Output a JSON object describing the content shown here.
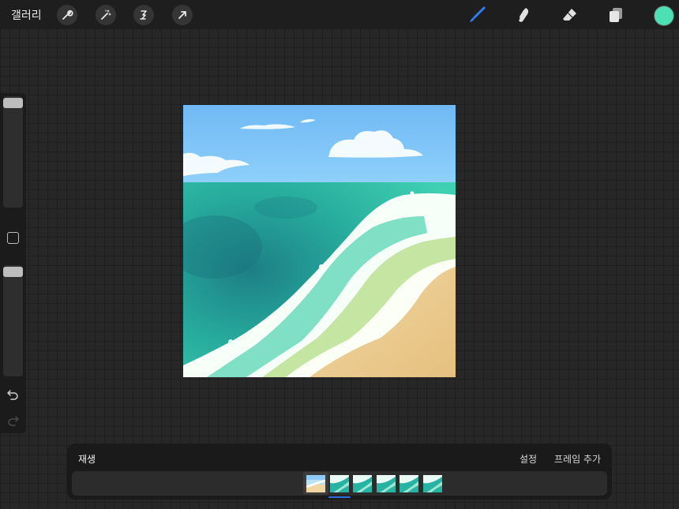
{
  "topbar": {
    "gallery_label": "갤러리",
    "left_tools": [
      "wrench-icon",
      "magic-wand-icon",
      "selection-icon",
      "transform-arrow-icon"
    ],
    "right_tools": [
      "brush-icon",
      "smudge-icon",
      "eraser-icon",
      "layers-icon"
    ],
    "active_tool": "brush-icon",
    "current_color": "#4de0b4"
  },
  "sidebar": {
    "brush_size_level": 0.0,
    "opacity_level": 0.0
  },
  "canvas": {
    "scene": "beach-illustration",
    "sky_color": "#7cc4f6",
    "sea_color": "#2fb9a4",
    "sand_color": "#ecc98d"
  },
  "animation": {
    "play_label": "재생",
    "settings_label": "설정",
    "add_frame_label": "프레임 추가",
    "frames": [
      {
        "name": "frame-1"
      },
      {
        "name": "frame-2"
      },
      {
        "name": "frame-3"
      },
      {
        "name": "frame-4"
      },
      {
        "name": "frame-5"
      },
      {
        "name": "frame-6"
      }
    ],
    "selected_frame": 2
  }
}
